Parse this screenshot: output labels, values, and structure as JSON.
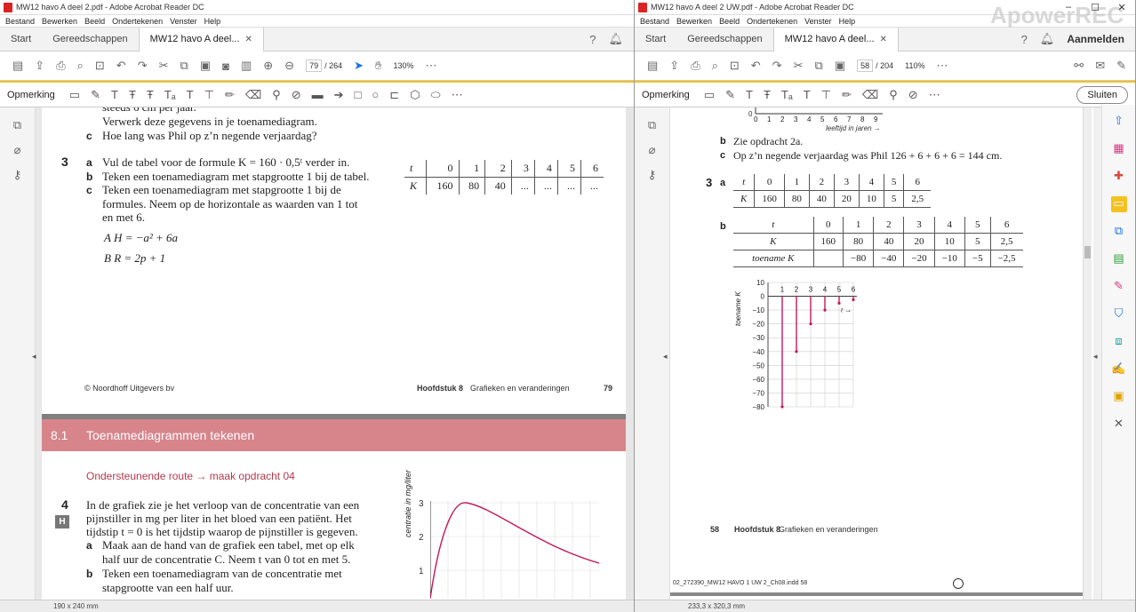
{
  "left": {
    "title": "MW12 havo A deel 2.pdf - Adobe Acrobat Reader DC",
    "menu": [
      "Bestand",
      "Bewerken",
      "Beeld",
      "Ondertekenen",
      "Venster",
      "Help"
    ],
    "tabs": {
      "start": "Start",
      "tools": "Gereedschappen",
      "doc": "MW12 havo A deel..."
    },
    "page_current": "79",
    "page_total": "/ 264",
    "zoom": "130%",
    "comment_label": "Opmerking",
    "p1": {
      "l0": "steeds 6 cm per jaar.",
      "l1": "Verwerk deze gegevens in je toenamediagram.",
      "l2c": "c",
      "l2": "Hoe lang was Phil op z’n negende verjaardag?",
      "q3": "3",
      "a": "a",
      "a_text": "Vul de tabel voor de formule K = 160 · 0,5ᵗ verder in.",
      "b": "b",
      "b_text": "Teken een toenamediagram met stapgrootte 1 bij de tabel.",
      "c": "c",
      "c_text1": "Teken een toenamediagram met stapgrootte 1 bij de",
      "c_text2": "formules. Neem op de horizontale as waarden van 1 tot",
      "c_text3": "en met 6.",
      "fA": "A   H = −a² + 6a",
      "fB": "B   R = 2p + 1",
      "table": {
        "r1": [
          "t",
          "0",
          "1",
          "2",
          "3",
          "4",
          "5",
          "6"
        ],
        "r2": [
          "K",
          "160",
          "80",
          "40",
          "...",
          "...",
          "...",
          "..."
        ]
      },
      "footer_left": "© Noordhoff Uitgevers bv",
      "footer_chap": "Hoofdstuk 8",
      "footer_title": "Grafieken en veranderingen",
      "footer_num": "79"
    },
    "p2": {
      "sec_num": "8.1",
      "sec_title": "Toenamediagrammen tekenen",
      "route": "Ondersteunende route → maak opdracht 04",
      "q4": "4",
      "h": "H",
      "l1": "In de grafiek zie je het verloop van de concentratie van een",
      "l2": "pijnstiller in mg per liter in het bloed van een patiënt. Het",
      "l3": "tijdstip t = 0 is het tijdstip waarop de pijnstiller is gegeven.",
      "a": "a",
      "a1": "Maak aan de hand van de grafiek een tabel, met op elk",
      "a2": "half uur de concentratie C. Neem t van 0 tot en met 5.",
      "b": "b",
      "b1": "Teken een toenamediagram van de concentratie met",
      "b2": "stapgrootte van een half uur.",
      "yaxis": "centratie in mg/liter",
      "yticks": [
        "3",
        "2",
        "1"
      ]
    },
    "status": "190 x 240 mm"
  },
  "right": {
    "title": "MW12 havo A deel 2 UW.pdf - Adobe Acrobat Reader DC",
    "menu": [
      "Bestand",
      "Bewerken",
      "Beeld",
      "Ondertekenen",
      "Venster",
      "Help"
    ],
    "tabs": {
      "start": "Start",
      "tools": "Gereedschappen",
      "doc": "MW12 havo A deel..."
    },
    "signin": "Aanmelden",
    "watermark": "ApowerREC",
    "page_current": "58",
    "page_total": "/ 204",
    "zoom": "110%",
    "comment_label": "Opmerking",
    "close": "Sluiten",
    "axis_ticks": [
      "0",
      "1",
      "2",
      "3",
      "4",
      "5",
      "6",
      "7",
      "8",
      "9"
    ],
    "axis_zero": "0",
    "axis_label": "leeftijd in jaren →",
    "l_b": "b",
    "l_b_text": "Zie opdracht 2a.",
    "l_c": "c",
    "l_c_text": "Op z’n negende verjaardag was Phil 126 + 6 + 6 + 6 = 144 cm.",
    "q3": "3",
    "a": "a",
    "b": "b",
    "tableA": {
      "r1": [
        "t",
        "0",
        "1",
        "2",
        "3",
        "4",
        "5",
        "6"
      ],
      "r2": [
        "K",
        "160",
        "80",
        "40",
        "20",
        "10",
        "5",
        "2,5"
      ]
    },
    "tableB": {
      "r1": [
        "t",
        "0",
        "1",
        "2",
        "3",
        "4",
        "5",
        "6"
      ],
      "r2": [
        "K",
        "160",
        "80",
        "40",
        "20",
        "10",
        "5",
        "2,5"
      ],
      "r3": [
        "toename K",
        "",
        "−80",
        "−40",
        "−20",
        "−10",
        "−5",
        "−2,5"
      ]
    },
    "chart_ylabel": "toename K",
    "chart_xlabel": "t",
    "footer_num": "58",
    "footer_chap": "Hoofdstuk 8",
    "footer_title": "Grafieken en veranderingen",
    "indd": "02_272390_MW12 HAVO 1 UW 2_Ch08.indd   58",
    "status": "233,3 x 320,3 mm"
  },
  "chart_data": {
    "type": "bar",
    "title": "",
    "xlabel": "t",
    "ylabel": "toename K",
    "categories": [
      "1",
      "2",
      "3",
      "4",
      "5",
      "6"
    ],
    "values": [
      -80,
      -40,
      -20,
      -10,
      -5,
      -2.5
    ],
    "yticks": [
      "10",
      "0",
      "−10",
      "−20",
      "−30",
      "−40",
      "−50",
      "−60",
      "−70",
      "−80"
    ],
    "ylim": [
      -80,
      10
    ],
    "color": "#c2185b"
  }
}
